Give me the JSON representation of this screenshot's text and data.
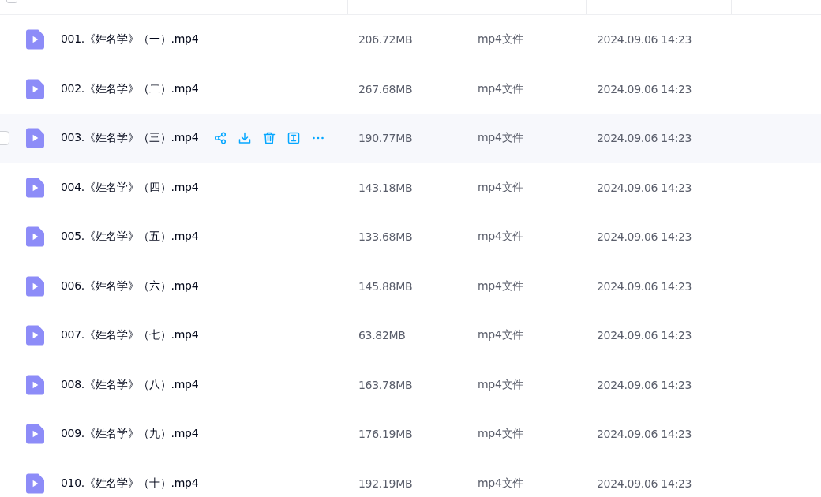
{
  "file_list": {
    "header": {
      "select_all": {
        "checked": false
      }
    },
    "rows": [
      {
        "name": "001.《姓名学》（一）.mp4",
        "size": "206.72MB",
        "type": "mp4文件",
        "modified": "2024.09.06 14:23",
        "hovered": false
      },
      {
        "name": "002.《姓名学》（二）.mp4",
        "size": "267.68MB",
        "type": "mp4文件",
        "modified": "2024.09.06 14:23",
        "hovered": false
      },
      {
        "name": "003.《姓名学》（三）.mp4",
        "size": "190.77MB",
        "type": "mp4文件",
        "modified": "2024.09.06 14:23",
        "hovered": true
      },
      {
        "name": "004.《姓名学》（四）.mp4",
        "size": "143.18MB",
        "type": "mp4文件",
        "modified": "2024.09.06 14:23",
        "hovered": false
      },
      {
        "name": "005.《姓名学》（五）.mp4",
        "size": "133.68MB",
        "type": "mp4文件",
        "modified": "2024.09.06 14:23",
        "hovered": false
      },
      {
        "name": "006.《姓名学》（六）.mp4",
        "size": "145.88MB",
        "type": "mp4文件",
        "modified": "2024.09.06 14:23",
        "hovered": false
      },
      {
        "name": "007.《姓名学》（七）.mp4",
        "size": "63.82MB",
        "type": "mp4文件",
        "modified": "2024.09.06 14:23",
        "hovered": false
      },
      {
        "name": "008.《姓名学》（八）.mp4",
        "size": "163.78MB",
        "type": "mp4文件",
        "modified": "2024.09.06 14:23",
        "hovered": false
      },
      {
        "name": "009.《姓名学》（九）.mp4",
        "size": "176.19MB",
        "type": "mp4文件",
        "modified": "2024.09.06 14:23",
        "hovered": false
      },
      {
        "name": "010.《姓名学》（十）.mp4",
        "size": "192.19MB",
        "type": "mp4文件",
        "modified": "2024.09.06 14:23",
        "hovered": false
      }
    ]
  }
}
